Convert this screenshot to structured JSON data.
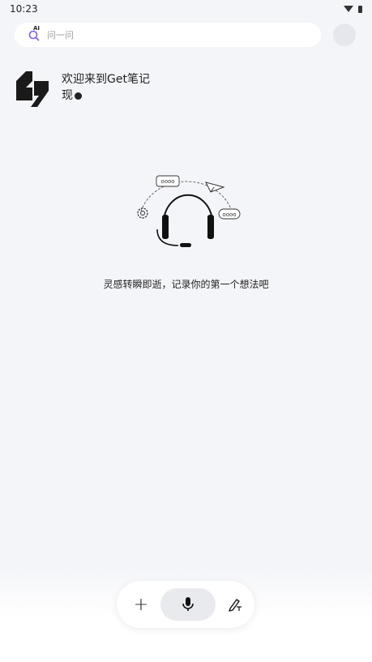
{
  "status_bar": {
    "time": "10:23"
  },
  "search": {
    "ai_badge": "AI",
    "placeholder": "问一问"
  },
  "welcome": {
    "line1": "欢迎来到Get笔记",
    "line2": "现"
  },
  "empty_state": {
    "message": "灵感转瞬即逝，记录你的第一个想法吧"
  },
  "toolbar": {
    "add_symbol": "+"
  },
  "colors": {
    "background": "#f4f5f9",
    "accent_purple": "#7b5cf0",
    "text": "#222222"
  }
}
